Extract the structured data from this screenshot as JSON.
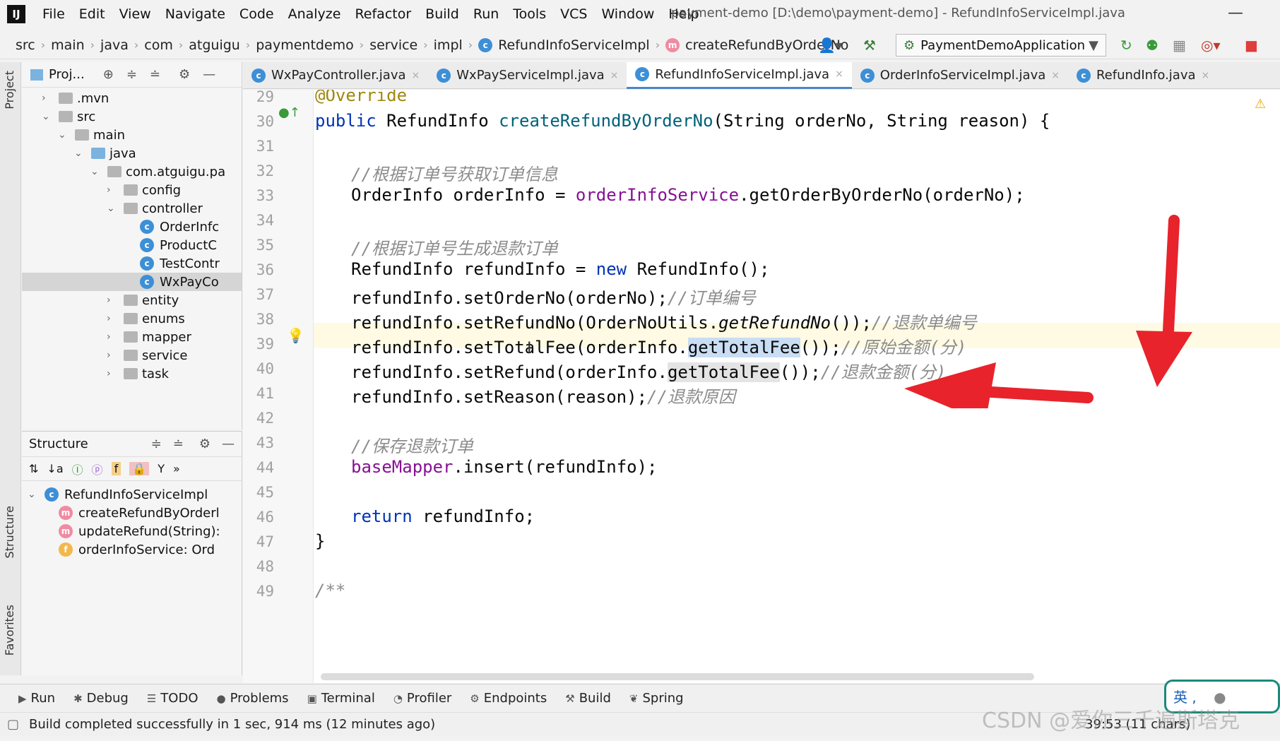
{
  "app": {
    "logo": "IJ",
    "menu": [
      "File",
      "Edit",
      "View",
      "Navigate",
      "Code",
      "Analyze",
      "Refactor",
      "Build",
      "Run",
      "Tools",
      "VCS",
      "Window",
      "Help"
    ],
    "window_title": "payment-demo [D:\\demo\\payment-demo] - RefundInfoServiceImpl.java"
  },
  "breadcrumb": {
    "items": [
      "src",
      "main",
      "java",
      "com",
      "atguigu",
      "paymentdemo",
      "service",
      "impl"
    ],
    "class_crumb": "RefundInfoServiceImpl",
    "method_crumb": "createRefundByOrderNo"
  },
  "run_config": "PaymentDemoApplication",
  "left_strip": {
    "project": "Project",
    "structure": "Structure",
    "favorites": "Favorites"
  },
  "project_panel": {
    "title": "Proj...",
    "tree": [
      {
        "label": ".mvn",
        "arrow": "›",
        "indent": 0,
        "kind": "folder"
      },
      {
        "label": "src",
        "arrow": "⌄",
        "indent": 0,
        "kind": "folder"
      },
      {
        "label": "main",
        "arrow": "⌄",
        "indent": 1,
        "kind": "folder"
      },
      {
        "label": "java",
        "arrow": "⌄",
        "indent": 2,
        "kind": "folder-blue"
      },
      {
        "label": "com.atguigu.pa",
        "arrow": "⌄",
        "indent": 3,
        "kind": "folder"
      },
      {
        "label": "config",
        "arrow": "›",
        "indent": 4,
        "kind": "folder"
      },
      {
        "label": "controller",
        "arrow": "⌄",
        "indent": 4,
        "kind": "folder"
      },
      {
        "label": "OrderInfc",
        "arrow": "",
        "indent": 5,
        "kind": "class"
      },
      {
        "label": "ProductC",
        "arrow": "",
        "indent": 5,
        "kind": "class"
      },
      {
        "label": "TestContr",
        "arrow": "",
        "indent": 5,
        "kind": "class"
      },
      {
        "label": "WxPayCo",
        "arrow": "",
        "indent": 5,
        "kind": "class",
        "selected": true
      },
      {
        "label": "entity",
        "arrow": "›",
        "indent": 4,
        "kind": "folder"
      },
      {
        "label": "enums",
        "arrow": "›",
        "indent": 4,
        "kind": "folder"
      },
      {
        "label": "mapper",
        "arrow": "›",
        "indent": 4,
        "kind": "folder"
      },
      {
        "label": "service",
        "arrow": "›",
        "indent": 4,
        "kind": "folder"
      },
      {
        "label": "task",
        "arrow": "›",
        "indent": 4,
        "kind": "folder"
      }
    ]
  },
  "structure_panel": {
    "title": "Structure",
    "items": [
      {
        "label": "RefundInfoServiceImpl",
        "icon": "c"
      },
      {
        "label": "createRefundByOrderl",
        "icon": "m"
      },
      {
        "label": "updateRefund(String):",
        "icon": "m"
      },
      {
        "label": "orderInfoService: Ord",
        "icon": "f"
      }
    ]
  },
  "tabs": [
    {
      "label": "WxPayController.java",
      "active": false
    },
    {
      "label": "WxPayServiceImpl.java",
      "active": false
    },
    {
      "label": "RefundInfoServiceImpl.java",
      "active": true
    },
    {
      "label": "OrderInfoServiceImpl.java",
      "active": false
    },
    {
      "label": "RefundInfo.java",
      "active": false
    }
  ],
  "editor": {
    "line_numbers": [
      "29",
      "30",
      "31",
      "32",
      "33",
      "34",
      "35",
      "36",
      "37",
      "38",
      "39",
      "40",
      "41",
      "42",
      "43",
      "44",
      "45",
      "46",
      "47",
      "48",
      "49"
    ],
    "code": {
      "l29": "@Override",
      "l30_kw": "public",
      "l30_type": " RefundInfo ",
      "l30_fn": "createRefundByOrderNo",
      "l30_rest": "(String orderNo, String reason) {",
      "l32": "//根据订单号获取订单信息",
      "l33_a": "OrderInfo orderInfo = ",
      "l33_fld": "orderInfoService",
      "l33_b": ".getOrderByOrderNo(orderNo);",
      "l35": "//根据订单号生成退款订单",
      "l36_a": "RefundInfo refundInfo = ",
      "l36_kw": "new",
      "l36_b": " RefundInfo();",
      "l37_a": "refundInfo.setOrderNo(orderNo);",
      "l37_cm": "//订单编号",
      "l38_a": "refundInfo.setRefundNo(OrderNoUtils.",
      "l38_it": "getRefundNo",
      "l38_b": "());",
      "l38_cm": "//退款单编号",
      "l39_a": "refundInfo.setTotalFee(orderInfo.",
      "l39_hl": "getTotalFee",
      "l39_b": "());",
      "l39_cm": "//原始金额(分)",
      "l40_a": "refundInfo.setRefund(orderInfo.",
      "l40_hl": "getTotalFee",
      "l40_b": "());",
      "l40_cm": "//退款金额(分)",
      "l41_a": "refundInfo.setReason(reason);",
      "l41_cm": "//退款原因",
      "l43": "//保存退款订单",
      "l44_fld": "baseMapper",
      "l44_b": ".insert(refundInfo);",
      "l46_kw": "return",
      "l46_b": " refundInfo;",
      "l47": "}",
      "l49": "/**"
    }
  },
  "bottom_tools": [
    {
      "label": "Run",
      "icon": "▶"
    },
    {
      "label": "Debug",
      "icon": "✱"
    },
    {
      "label": "TODO",
      "icon": "☰"
    },
    {
      "label": "Problems",
      "icon": "●"
    },
    {
      "label": "Terminal",
      "icon": "▣"
    },
    {
      "label": "Profiler",
      "icon": "◔"
    },
    {
      "label": "Endpoints",
      "icon": "⚙"
    },
    {
      "label": "Build",
      "icon": "⚒"
    },
    {
      "label": "Spring",
      "icon": "❦"
    }
  ],
  "status": {
    "message": "Build completed successfully in 1 sec, 914 ms (12 minutes ago)",
    "position": "39:53 (11 chars)"
  },
  "ime": {
    "text": "英 ,"
  },
  "watermark": "CSDN @爱你三千遍斯塔克",
  "colors": {
    "arrow": "#e8232b",
    "accent": "#4a86c8"
  }
}
